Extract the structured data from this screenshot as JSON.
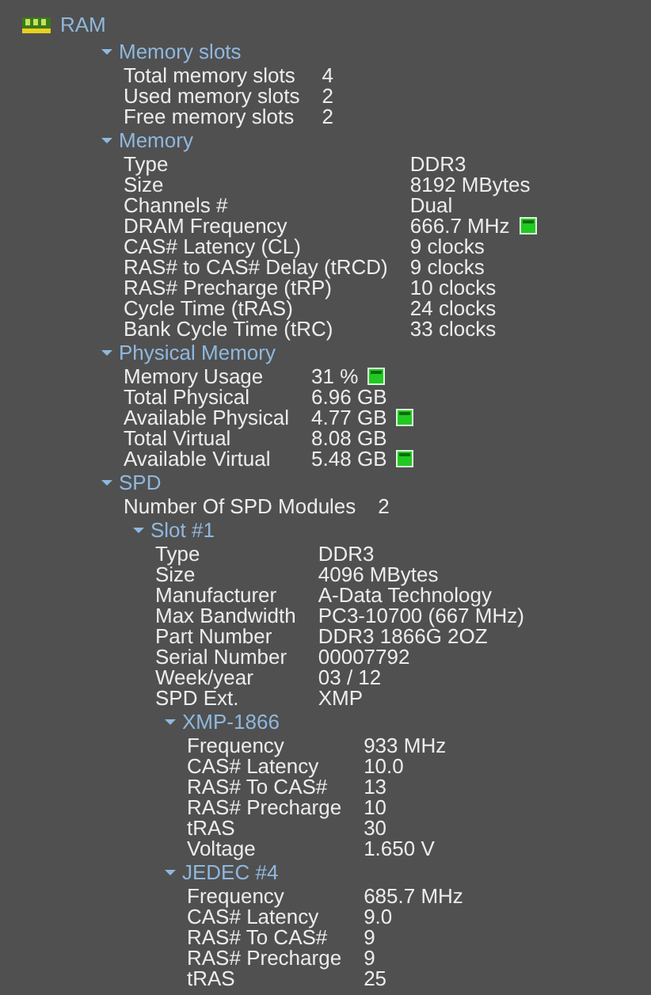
{
  "root": {
    "title": "RAM",
    "expanded": true
  },
  "sections": [
    {
      "title": "Memory slots",
      "expanded": true,
      "rows": [
        {
          "label": "Total memory slots",
          "value": "4"
        },
        {
          "label": "Used memory slots",
          "value": "2"
        },
        {
          "label": "Free memory slots",
          "value": "2"
        }
      ]
    },
    {
      "title": "Memory",
      "expanded": true,
      "rows": [
        {
          "label": "Type",
          "value": "DDR3",
          "meter": false
        },
        {
          "label": "Size",
          "value": "8192 MBytes",
          "meter": false
        },
        {
          "label": "Channels #",
          "value": "Dual",
          "meter": false
        },
        {
          "label": "DRAM Frequency",
          "value": "666.7 MHz",
          "meter": true
        },
        {
          "label": "CAS# Latency (CL)",
          "value": "9 clocks",
          "meter": false
        },
        {
          "label": "RAS# to CAS# Delay (tRCD)",
          "value": "9 clocks",
          "meter": false
        },
        {
          "label": "RAS# Precharge (tRP)",
          "value": "10 clocks",
          "meter": false
        },
        {
          "label": "Cycle Time (tRAS)",
          "value": "24 clocks",
          "meter": false
        },
        {
          "label": "Bank Cycle Time (tRC)",
          "value": "33 clocks",
          "meter": false
        }
      ]
    },
    {
      "title": "Physical Memory",
      "expanded": true,
      "rows": [
        {
          "label": "Memory Usage",
          "value": "31 %",
          "meter": true
        },
        {
          "label": "Total Physical",
          "value": "6.96 GB",
          "meter": false
        },
        {
          "label": "Available Physical",
          "value": "4.77 GB",
          "meter": true
        },
        {
          "label": "Total Virtual",
          "value": "8.08 GB",
          "meter": false
        },
        {
          "label": "Available Virtual",
          "value": "5.48 GB",
          "meter": true
        }
      ]
    },
    {
      "title": "SPD",
      "expanded": true,
      "rows": [
        {
          "label": "Number Of SPD Modules",
          "value": "2"
        }
      ],
      "children": [
        {
          "title": "Slot #1",
          "expanded": true,
          "rows": [
            {
              "label": "Type",
              "value": "DDR3"
            },
            {
              "label": "Size",
              "value": "4096 MBytes"
            },
            {
              "label": "Manufacturer",
              "value": "A-Data Technology"
            },
            {
              "label": "Max Bandwidth",
              "value": "PC3-10700 (667 MHz)"
            },
            {
              "label": "Part Number",
              "value": "DDR3 1866G 2OZ"
            },
            {
              "label": "Serial Number",
              "value": "00007792"
            },
            {
              "label": "Week/year",
              "value": "03 / 12"
            },
            {
              "label": "SPD Ext.",
              "value": "XMP"
            }
          ],
          "children": [
            {
              "title": "XMP-1866",
              "expanded": true,
              "rows": [
                {
                  "label": "Frequency",
                  "value": "933 MHz"
                },
                {
                  "label": "CAS# Latency",
                  "value": "10.0"
                },
                {
                  "label": "RAS# To CAS#",
                  "value": "13"
                },
                {
                  "label": "RAS# Precharge",
                  "value": "10"
                },
                {
                  "label": "tRAS",
                  "value": "30"
                },
                {
                  "label": "Voltage",
                  "value": "1.650 V"
                }
              ]
            },
            {
              "title": "JEDEC #4",
              "expanded": true,
              "rows": [
                {
                  "label": "Frequency",
                  "value": "685.7 MHz"
                },
                {
                  "label": "CAS# Latency",
                  "value": "9.0"
                },
                {
                  "label": "RAS# To CAS#",
                  "value": "9"
                },
                {
                  "label": "RAS# Precharge",
                  "value": "9"
                },
                {
                  "label": "tRAS",
                  "value": "25"
                }
              ]
            }
          ]
        }
      ]
    }
  ]
}
